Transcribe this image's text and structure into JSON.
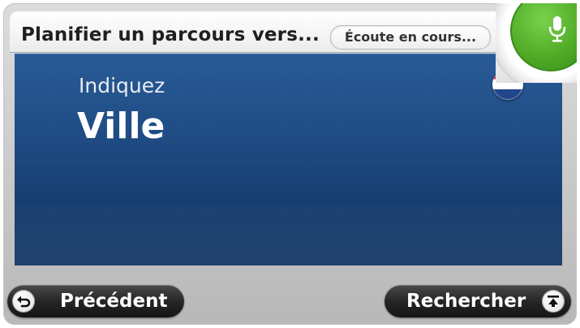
{
  "header": {
    "title": "Planifier un parcours vers...",
    "listening_status": "Écoute en cours..."
  },
  "main": {
    "prompt": "Indiquez",
    "field_value": "Ville",
    "country_flag": "netherlands-flag-icon"
  },
  "mic": {
    "icon": "microphone-icon",
    "color": "#4ea824"
  },
  "footer": {
    "back_label": "Précédent",
    "search_label": "Rechercher"
  },
  "colors": {
    "panel": "#1f4b83",
    "button": "#262626",
    "accent_green": "#4ea824"
  }
}
